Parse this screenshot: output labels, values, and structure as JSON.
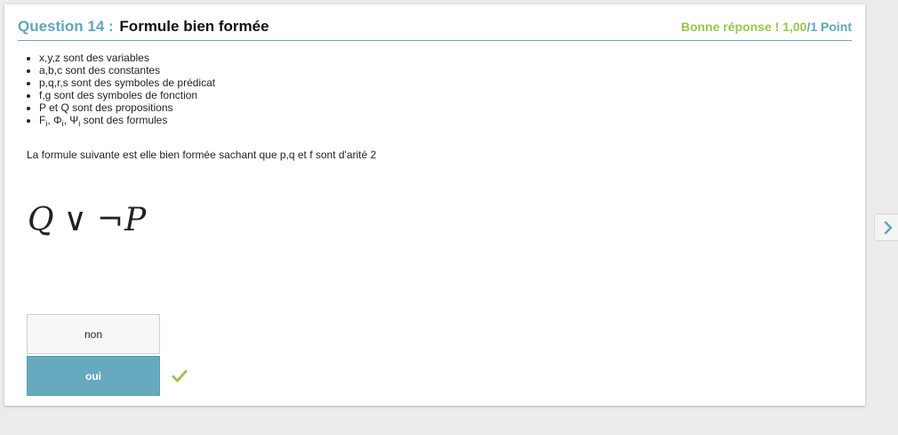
{
  "question": {
    "label": "Question 14 :",
    "title": "Formule bien formée",
    "score_feedback": "Bonne réponse ! 1,00",
    "score_points": "/1 Point"
  },
  "definitions": [
    {
      "text": "x,y,z sont des variables"
    },
    {
      "text": "a,b,c sont des constantes"
    },
    {
      "text": "p,q,r,s sont des symboles de prédicat"
    },
    {
      "text": "f,g sont des symboles de fonction"
    },
    {
      "text": "P et Q sont des propositions"
    },
    {
      "F": "F",
      "i1": "i",
      "Phi": "Φ",
      "i2": "i",
      "Psi": "Ψ",
      "i3": "i",
      "rest": " sont des formules"
    }
  ],
  "prompt": "La formule suivante est elle bien formée sachant que p,q et f sont d'arité 2",
  "formula": {
    "left": "Q",
    "op1": "∨",
    "op2": "¬",
    "right": "P"
  },
  "answers": [
    {
      "label": "non",
      "selected": false
    },
    {
      "label": "oui",
      "selected": true,
      "correct": true
    }
  ],
  "icons": {
    "correct": "checkmark-icon",
    "next": "chevron-right-icon"
  },
  "colors": {
    "accent": "#5fa5bb",
    "correct": "#9ac64a",
    "selected_answer": "#66aac0"
  }
}
